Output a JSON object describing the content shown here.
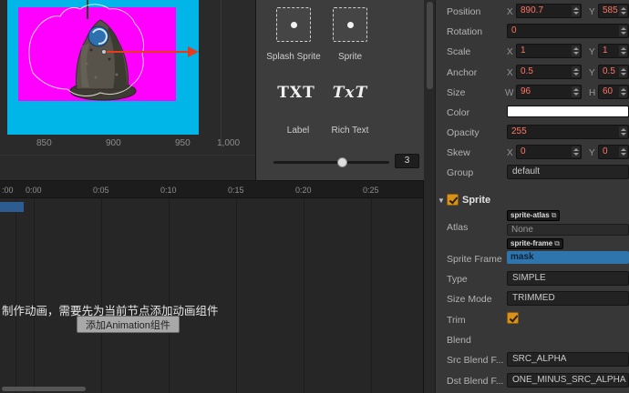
{
  "colors": {
    "canvas_background": "#00b6e8",
    "sprite_bounds_magenta": "#ff00ff",
    "gizmo_arrow_red": "#e83b1d",
    "checkbox_orange": "#d8921b",
    "selected_frame_blue": "#2e74ad",
    "number_value_text": "#ff7663",
    "color_property_value": "#ffffff"
  },
  "icons": {
    "external_link": "⧉",
    "collapse_arrow": "▼"
  },
  "scene": {
    "ruler_labels": [
      "850",
      "900",
      "950",
      "1,000"
    ]
  },
  "palette": {
    "items": [
      {
        "label": "Splash Sprite",
        "icon": "sprite-icon"
      },
      {
        "label": "Sprite",
        "icon": "sprite-icon"
      },
      {
        "label": "Label",
        "icon_text": "TXT"
      },
      {
        "label": "Rich Text",
        "icon_text": "TxT"
      }
    ],
    "slider": {
      "value": "3"
    }
  },
  "timeline": {
    "time_labels": [
      ":00",
      "0:00",
      "0:05",
      "0:10",
      "0:15",
      "0:20",
      "0:25"
    ],
    "hint": "制作动画，需要先为当前节点添加动画组件",
    "add_animation_button": "添加Animation组件"
  },
  "inspector": {
    "axis": {
      "x": "X",
      "y": "Y",
      "w": "W",
      "h": "H"
    },
    "position": {
      "label": "Position",
      "x": "890.7",
      "y": "585"
    },
    "rotation": {
      "label": "Rotation",
      "value": "0"
    },
    "scale": {
      "label": "Scale",
      "x": "1",
      "y": "1"
    },
    "anchor": {
      "label": "Anchor",
      "x": "0.5",
      "y": "0.5"
    },
    "size": {
      "label": "Size",
      "w": "96",
      "h": "60"
    },
    "color": {
      "label": "Color",
      "value": "#FFFFFF"
    },
    "opacity": {
      "label": "Opacity",
      "value": "255"
    },
    "skew": {
      "label": "Skew",
      "x": "0",
      "y": "0"
    },
    "group": {
      "label": "Group",
      "value": "default"
    },
    "sprite": {
      "title": "Sprite",
      "checked": true,
      "atlas": {
        "label": "Atlas",
        "tag": "sprite-atlas",
        "value": "None"
      },
      "sprite_frame": {
        "label": "Sprite Frame",
        "tag": "sprite-frame",
        "value": "mask"
      },
      "type": {
        "label": "Type",
        "value": "SIMPLE"
      },
      "size_mode": {
        "label": "Size Mode",
        "value": "TRIMMED"
      },
      "trim": {
        "label": "Trim",
        "checked": true
      },
      "blend": {
        "label": "Blend"
      },
      "src_blend": {
        "label": "Src Blend F...",
        "value": "SRC_ALPHA"
      },
      "dst_blend": {
        "label": "Dst Blend F...",
        "value": "ONE_MINUS_SRC_ALPHA"
      }
    }
  }
}
